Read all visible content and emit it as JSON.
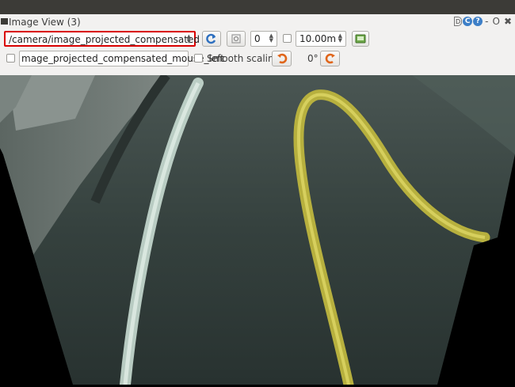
{
  "window": {
    "title": "Image View (3)",
    "controls": {
      "detach": "D",
      "reload": "C",
      "help": "?",
      "minimize": "-",
      "close_alt": "O",
      "close": "✖"
    }
  },
  "toolbar": {
    "topic": "/camera/image_projected_compensated",
    "zoom": "0",
    "max_range": "10.00m",
    "mouse_topic": "mage_projected_compensated_mouse_left",
    "smooth_scaling_label": "Smooth scaling",
    "rotation": "0°",
    "smooth_scaling_checked": false,
    "mouse_publish_checked": false,
    "dynamic_range_checked": false
  },
  "colors": {
    "accent_red": "#d90000",
    "panel_bg": "#f2f1f0",
    "topbar": "#3c3b37",
    "lane_yellow": "#c9c04a",
    "lane_white": "#c8dcd2",
    "floor": "#3a4542"
  },
  "icons": {
    "refresh": "refresh-icon",
    "zoom_fit": "zoom-fit-icon",
    "save": "save-image-icon",
    "rotate_left": "rotate-left-icon",
    "rotate_right": "rotate-right-icon"
  }
}
